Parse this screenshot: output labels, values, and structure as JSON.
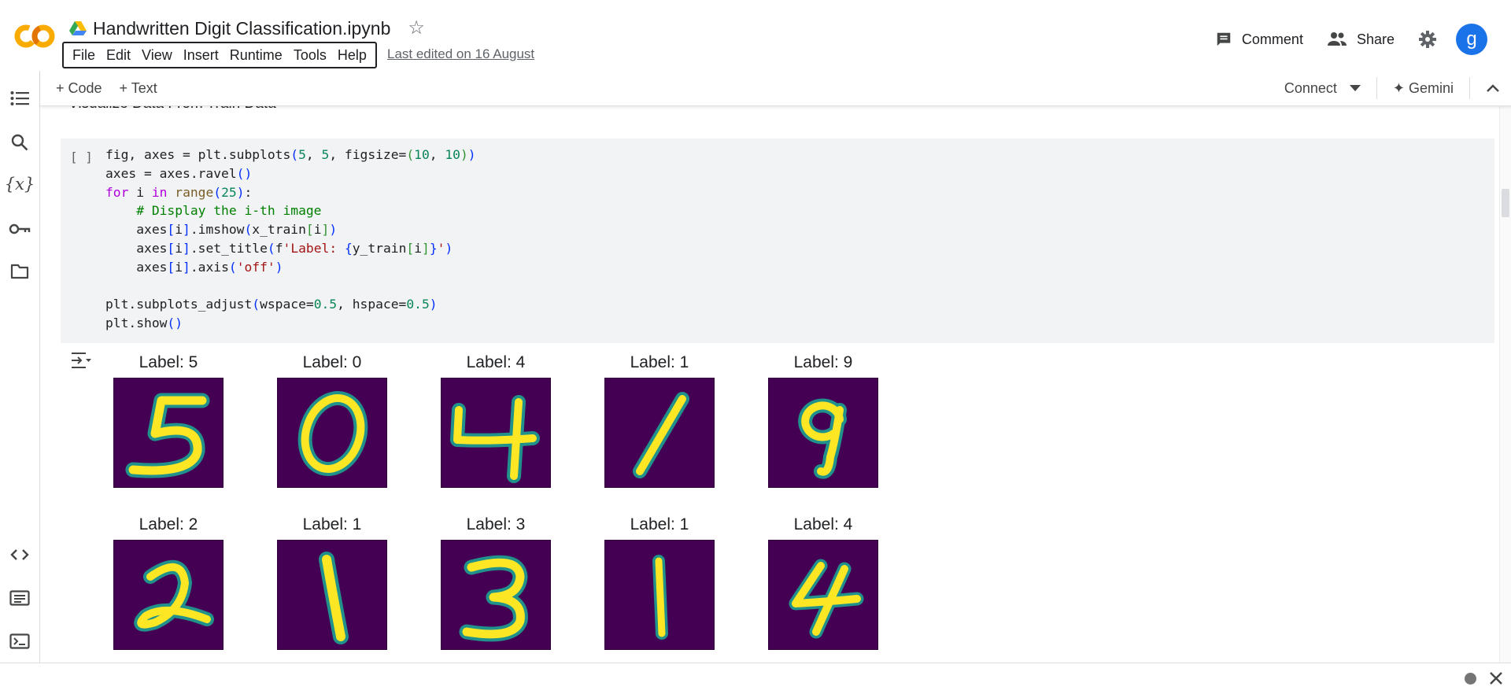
{
  "header": {
    "title": "Handwritten Digit Classification.ipynb",
    "menu": [
      "File",
      "Edit",
      "View",
      "Insert",
      "Runtime",
      "Tools",
      "Help"
    ],
    "last_edited": "Last edited on 16 August",
    "comment_label": "Comment",
    "share_label": "Share",
    "avatar_letter": "g"
  },
  "toolbar": {
    "add_code": "+ Code",
    "add_text": "+ Text",
    "connect": "Connect",
    "gemini": "✦ Gemini"
  },
  "sidebar": {
    "icons": [
      "table-of-contents-icon",
      "search-icon",
      "variables-icon",
      "secrets-key-icon",
      "files-folder-icon",
      "code-snippets-icon",
      "command-palette-icon",
      "terminal-icon"
    ],
    "variables_glyph": "{x}"
  },
  "notebook": {
    "section_heading": "Visualize Data From Train Data",
    "cell": {
      "exec_count": "[ ]",
      "code_lines": [
        "fig, axes = plt.subplots(5, 5, figsize=(10, 10))",
        "axes = axes.ravel()",
        "for i in range(25):",
        "    # Display the i-th image",
        "    axes[i].imshow(x_train[i])",
        "    axes[i].set_title(f'Label: {y_train[i]}')",
        "    axes[i].axis('off')",
        "",
        "plt.subplots_adjust(wspace=0.5, hspace=0.5)",
        "plt.show()"
      ]
    },
    "output": {
      "digits": [
        {
          "label": "Label: 5",
          "digit": "5"
        },
        {
          "label": "Label: 0",
          "digit": "0"
        },
        {
          "label": "Label: 4",
          "digit": "4"
        },
        {
          "label": "Label: 1",
          "digit": "1"
        },
        {
          "label": "Label: 9",
          "digit": "9"
        },
        {
          "label": "Label: 2",
          "digit": "2"
        },
        {
          "label": "Label: 1",
          "digit": "1"
        },
        {
          "label": "Label: 3",
          "digit": "3"
        },
        {
          "label": "Label: 1",
          "digit": "1"
        },
        {
          "label": "Label: 4",
          "digit": "4"
        }
      ],
      "colors": {
        "background": "#440154",
        "stroke": "#fde725",
        "edge": "#21918c"
      }
    }
  },
  "colors": {
    "brand_orange": "#f9ab00",
    "avatar_blue": "#1a73e8"
  }
}
